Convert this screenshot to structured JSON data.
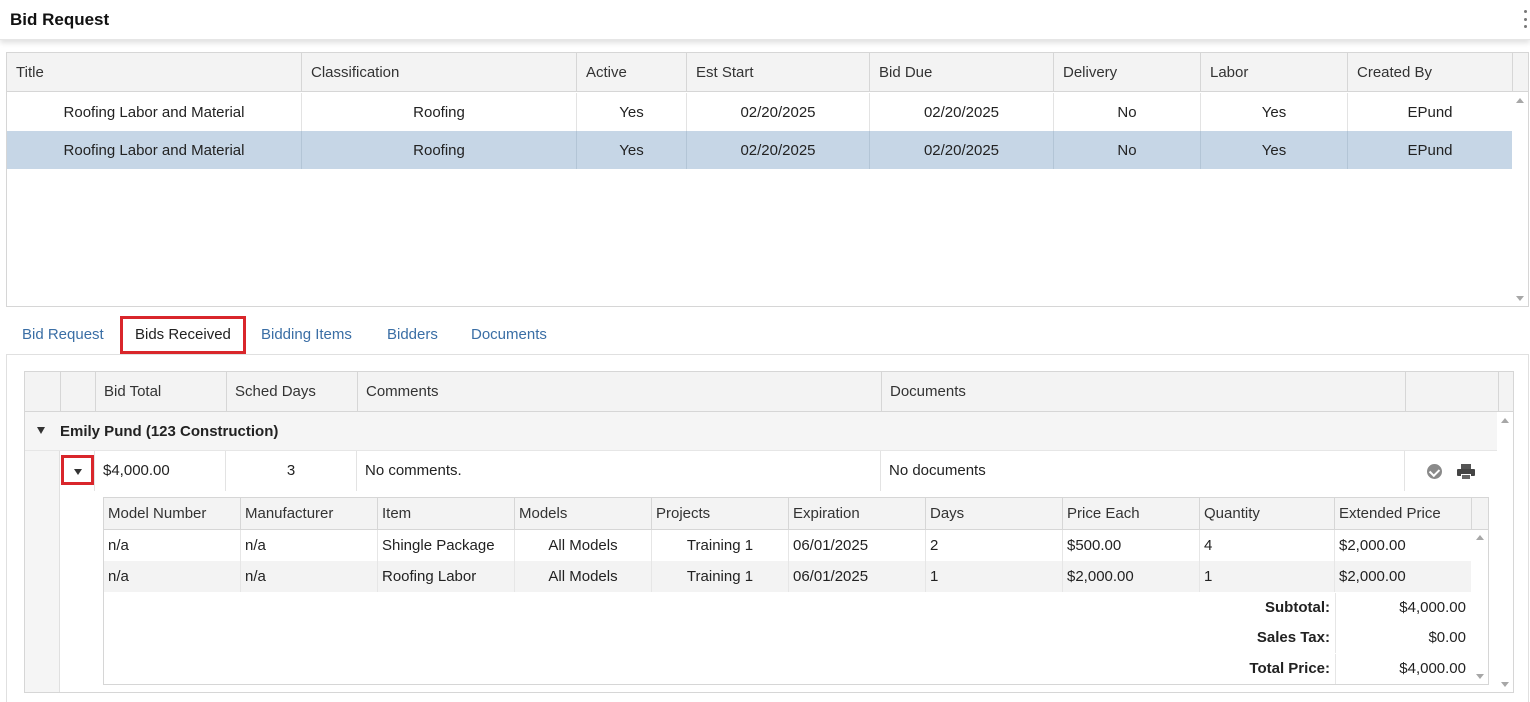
{
  "header": {
    "title": "Bid Request"
  },
  "top_grid": {
    "columns": [
      "Title",
      "Classification",
      "Active",
      "Est Start",
      "Bid Due",
      "Delivery",
      "Labor",
      "Created By"
    ],
    "rows": [
      {
        "title": "Roofing Labor and Material",
        "classification": "Roofing",
        "active": "Yes",
        "est_start": "02/20/2025",
        "bid_due": "02/20/2025",
        "delivery": "No",
        "labor": "Yes",
        "created_by": "EPund",
        "selected": false
      },
      {
        "title": "Roofing Labor and Material",
        "classification": "Roofing",
        "active": "Yes",
        "est_start": "02/20/2025",
        "bid_due": "02/20/2025",
        "delivery": "No",
        "labor": "Yes",
        "created_by": "EPund",
        "selected": true
      }
    ]
  },
  "tabs": [
    {
      "label": "Bid Request",
      "active": false
    },
    {
      "label": "Bids Received",
      "active": true
    },
    {
      "label": "Bidding Items",
      "active": false
    },
    {
      "label": "Bidders",
      "active": false
    },
    {
      "label": "Documents",
      "active": false
    }
  ],
  "bids_grid": {
    "columns": [
      "Bid Total",
      "Sched Days",
      "Comments",
      "Documents"
    ],
    "group": {
      "label": "Emily Pund (123 Construction)"
    },
    "bid_row": {
      "bid_total": "$4,000.00",
      "sched_days": "3",
      "comments": "No comments.",
      "documents": "No documents"
    },
    "icons": {
      "approve": "check-badge-icon",
      "print": "printer-icon"
    },
    "detail": {
      "columns": [
        "Model Number",
        "Manufacturer",
        "Item",
        "Models",
        "Projects",
        "Expiration",
        "Days",
        "Price Each",
        "Quantity",
        "Extended Price"
      ],
      "rows": [
        {
          "model_number": "n/a",
          "manufacturer": "n/a",
          "item": "Shingle Package",
          "models": "All Models",
          "projects": "Training 1",
          "expiration": "06/01/2025",
          "days": "2",
          "price_each": "$500.00",
          "quantity": "4",
          "extended_price": "$2,000.00"
        },
        {
          "model_number": "n/a",
          "manufacturer": "n/a",
          "item": "Roofing Labor",
          "models": "All Models",
          "projects": "Training 1",
          "expiration": "06/01/2025",
          "days": "1",
          "price_each": "$2,000.00",
          "quantity": "1",
          "extended_price": "$2,000.00"
        }
      ],
      "summary": {
        "subtotal_label": "Subtotal:",
        "subtotal_value": "$4,000.00",
        "tax_label": "Sales Tax:",
        "tax_value": "$0.00",
        "total_label": "Total Price:",
        "total_value": "$4,000.00"
      }
    }
  },
  "colors": {
    "accent_link": "#3a6ea5",
    "selected_row": "#c6d6e6",
    "highlight_border": "#d9262b"
  }
}
